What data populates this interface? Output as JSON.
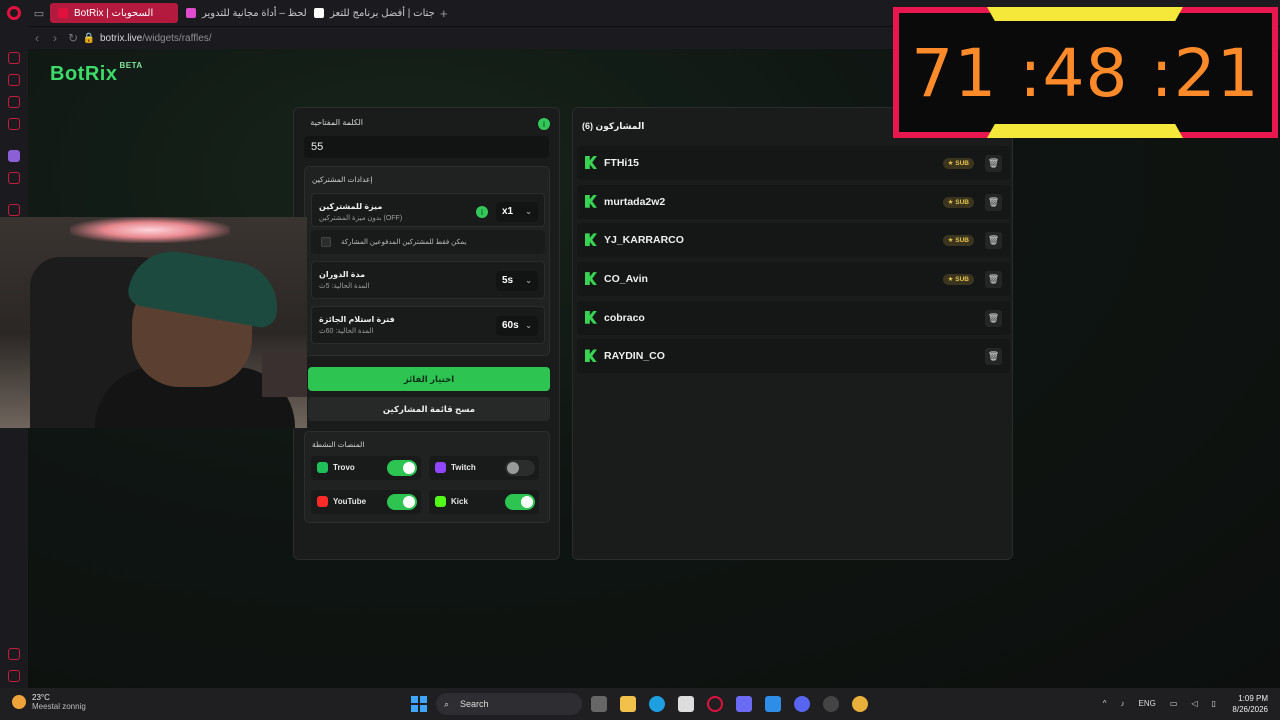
{
  "browser": {
    "tabs": [
      {
        "label": "BotRix | السحوبات",
        "active": true,
        "color": "#e0123d"
      },
      {
        "label": "عجلة الحظ – أداة مجانية للتدوير",
        "active": false,
        "color": "#e04bd0"
      },
      {
        "label": "الويدجتات | أفضل برنامج للتعز",
        "active": false,
        "color": "#ffffff"
      }
    ],
    "new_tab": "+",
    "url_host": "botrix.live",
    "url_path": "/widgets/raffles/"
  },
  "brand": {
    "name": "BotRix",
    "badge": "BETA"
  },
  "raffle": {
    "keyword_label": "الكلمة المفتاحية",
    "keyword_value": "55",
    "settings_title": "إعدادات المشتركين",
    "sub_bonus": {
      "title": "ميزة للمشتركين",
      "subtitle": "بدون ميزة المشتركين (OFF)",
      "value": "x1"
    },
    "subs_only_label": "يمكن فقط للمشتركين المدفوعين المشاركة",
    "spin_duration": {
      "title": "مدة الدوران",
      "subtitle": "المدة الحالية: 5ث",
      "value": "5s"
    },
    "claim_period": {
      "title": "فترة استلام الجائزة",
      "subtitle": "المدة الحالية: 60ث",
      "value": "60s"
    },
    "pick_winner": "اختيار الفائز",
    "clear_list": "مسح قائمة المشاركين",
    "platforms_title": "المنصات النشطة",
    "platforms": [
      {
        "name": "Trovo",
        "on": true,
        "color": "#1fbf5a"
      },
      {
        "name": "Twitch",
        "on": false,
        "color": "#9146ff"
      },
      {
        "name": "YouTube",
        "on": true,
        "color": "#ff2a2a"
      },
      {
        "name": "Kick",
        "on": true,
        "color": "#53fc18"
      }
    ]
  },
  "participants": {
    "title": "المشاركون (6)",
    "sub_badge": "★ SUB",
    "items": [
      {
        "name": "FTHi15",
        "sub": true
      },
      {
        "name": "murtada2w2",
        "sub": true
      },
      {
        "name": "YJ_KARRARCO",
        "sub": true
      },
      {
        "name": "CO_Avin",
        "sub": true
      },
      {
        "name": "cobraco",
        "sub": false
      },
      {
        "name": "RAYDIN_CO",
        "sub": false
      }
    ]
  },
  "timer": {
    "text": "71 :48 :21"
  },
  "taskbar": {
    "temp": "23°C",
    "weather": "Meestal zonnig",
    "search": "Search",
    "lang": "ENG",
    "time": "1:09 PM",
    "date": "8/26/2026"
  },
  "colors": {
    "accent": "#2ec452",
    "timer_border": "#e8174f",
    "timer_digits": "#ff8a2a"
  }
}
